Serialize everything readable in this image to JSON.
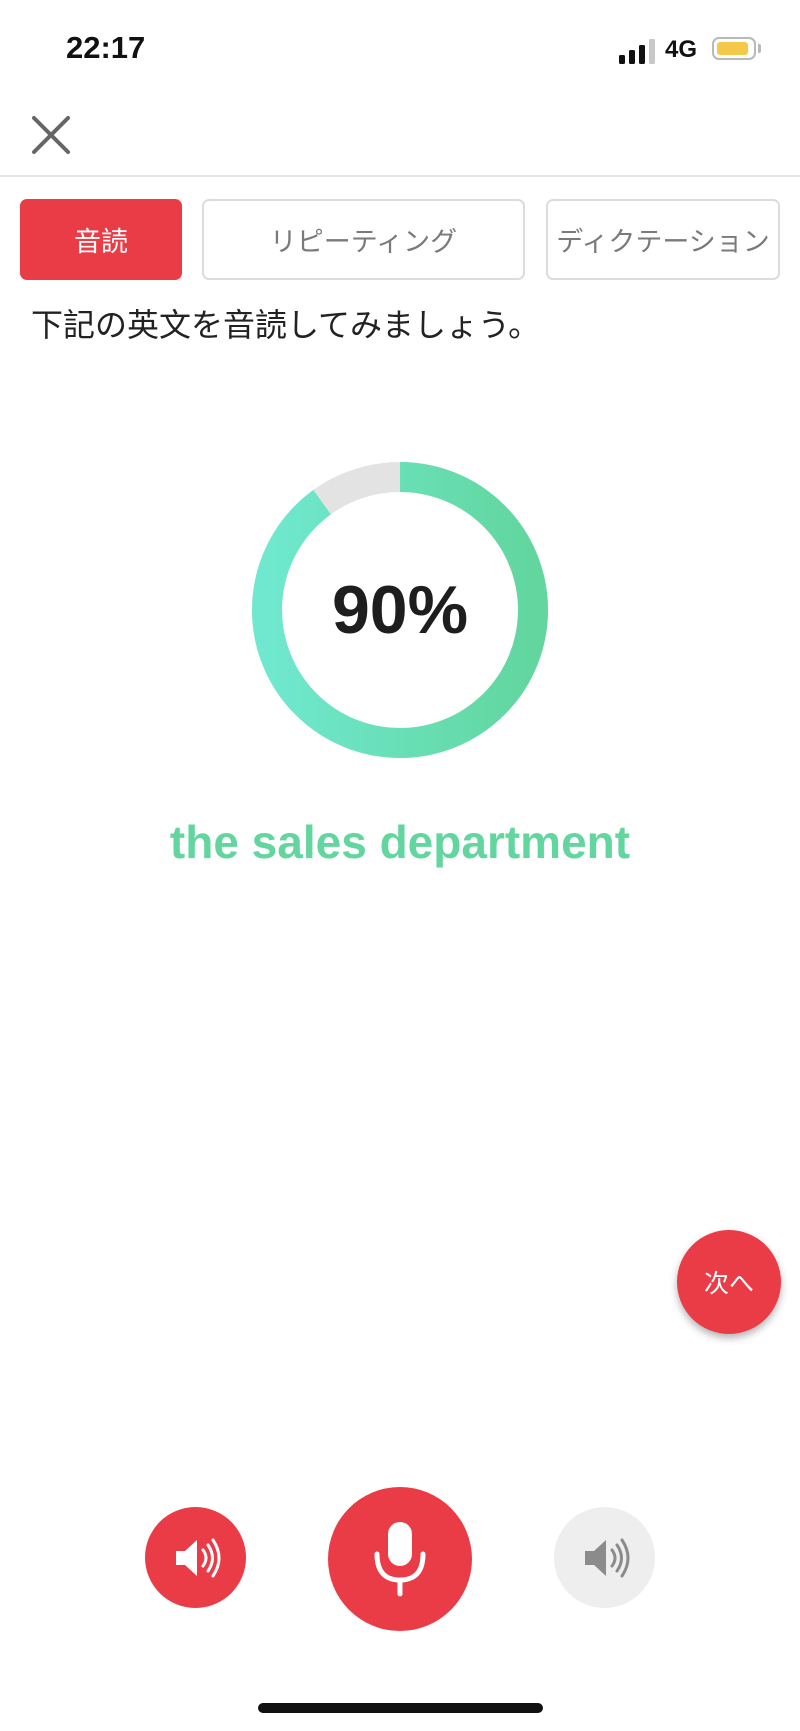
{
  "status_bar": {
    "time": "22:17",
    "network": "4G",
    "icons": [
      "signal-icon",
      "battery-icon"
    ],
    "battery_color": "#f4c94a"
  },
  "header": {
    "close_icon": "close-icon"
  },
  "tabs": [
    {
      "label": "音読",
      "active": true
    },
    {
      "label": "リピーティング",
      "active": false
    },
    {
      "label": "ディクテーション",
      "active": false
    }
  ],
  "instruction": "下記の英文を音読してみましょう。",
  "score": {
    "display": "90%",
    "fraction": 0.9,
    "gradient_colors": [
      "#6fe8cf",
      "#62d69e"
    ],
    "track_color": "#e3e3e3"
  },
  "phrase": "the sales department",
  "next_button": {
    "label": "次へ"
  },
  "controls": {
    "left": "speaker-icon",
    "center": "microphone-icon",
    "right": "speaker-icon"
  },
  "colors": {
    "accent": "#ea3c47",
    "phrase": "#62d69e",
    "inactive_tab_text": "#7a7a7a"
  }
}
